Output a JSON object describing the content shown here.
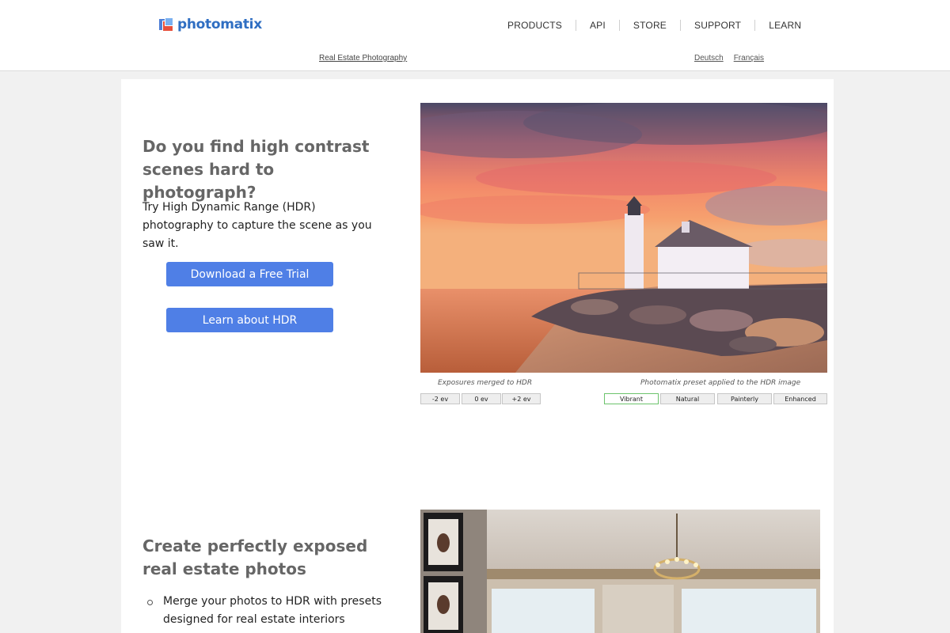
{
  "header": {
    "logo_text": "photomatix",
    "nav": [
      "PRODUCTS",
      "API",
      "STORE",
      "SUPPORT",
      "LEARN"
    ],
    "subnav_link": "Real Estate Photography",
    "languages": [
      "Deutsch",
      "Français"
    ]
  },
  "hero": {
    "headline": "Do you find high contrast scenes hard to photograph?",
    "lead": "Try High Dynamic Range (HDR) photography to capture the scene as you saw it.",
    "buttons": {
      "download": "Download a Free Trial",
      "learn": "Learn about HDR"
    },
    "exposures_caption": "Exposures merged to HDR",
    "exposure_tabs": [
      "-2 ev",
      "0 ev",
      "+2 ev"
    ],
    "preset_caption": "Photomatix preset applied to the HDR image",
    "preset_tabs": [
      "Vibrant",
      "Natural",
      "Painterly",
      "Enhanced"
    ],
    "active_preset": "Vibrant"
  },
  "realestate": {
    "headline": "Create perfectly exposed real estate photos",
    "bullets": [
      "Merge your photos to HDR with presets designed for real estate interiors"
    ]
  },
  "colors": {
    "accent": "#4f7fe6",
    "logo_blue": "#2f6ec2",
    "heading_gray": "#666666",
    "active_tab_border": "#6cc36c"
  }
}
